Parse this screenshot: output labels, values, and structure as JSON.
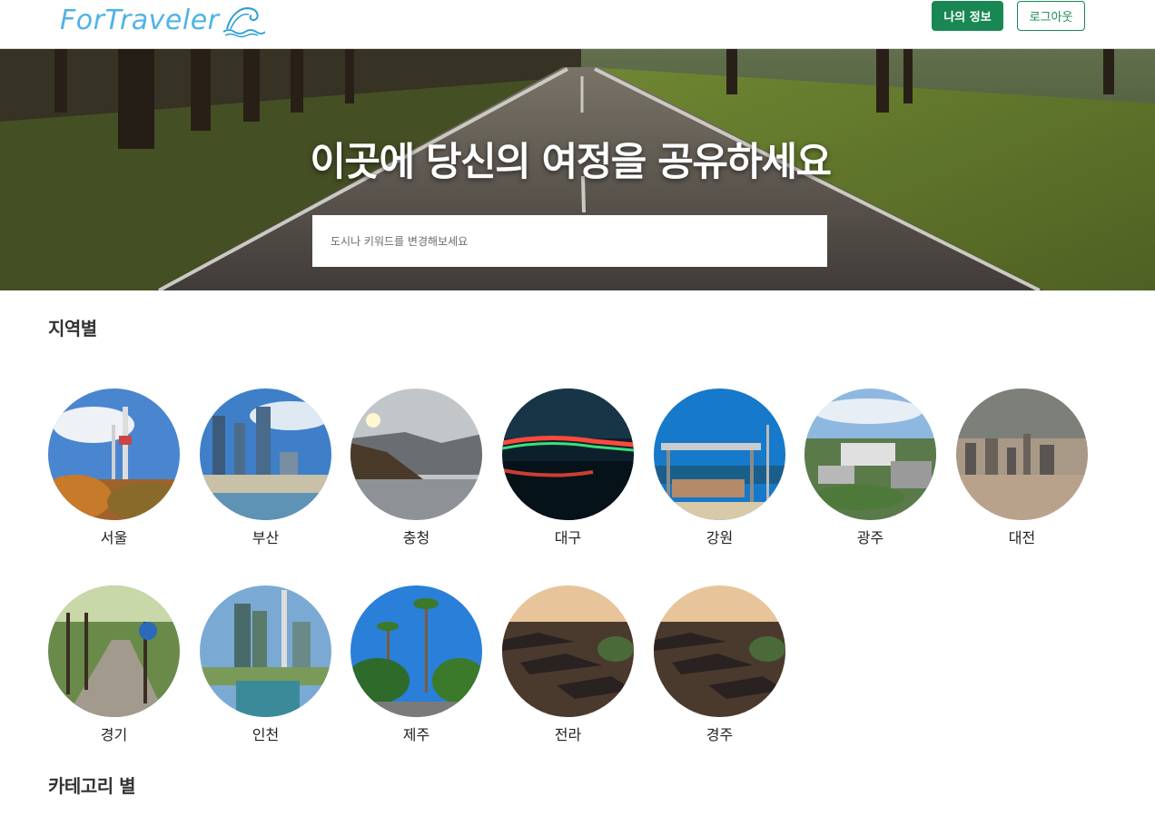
{
  "header": {
    "logo_text": "ForTraveler",
    "myinfo_label": "나의 정보",
    "logout_label": "로그아웃"
  },
  "hero": {
    "title": "이곳에 당신의 여정을 공유하세요",
    "search_placeholder": "도시나 키워드를 변경해보세요"
  },
  "regions_section": {
    "title": "지역별",
    "regions": [
      {
        "label": "서울"
      },
      {
        "label": "부산"
      },
      {
        "label": "충청"
      },
      {
        "label": "대구"
      },
      {
        "label": "강원"
      },
      {
        "label": "광주"
      },
      {
        "label": "대전"
      },
      {
        "label": "경기"
      },
      {
        "label": "인천"
      },
      {
        "label": "제주"
      },
      {
        "label": "전라"
      },
      {
        "label": "경주"
      }
    ]
  },
  "category_section": {
    "title": "카테고리 별"
  },
  "colors": {
    "primary_green": "#198754",
    "logo_blue": "#4fb3e6"
  }
}
